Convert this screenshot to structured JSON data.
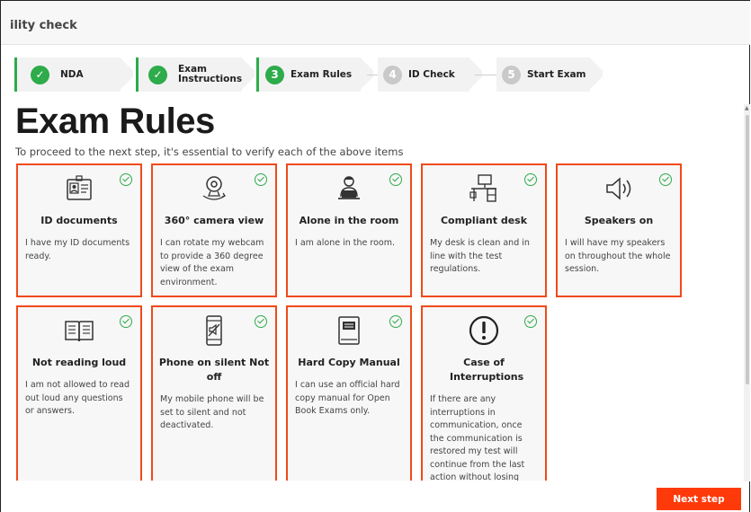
{
  "window": {
    "title": "ility check"
  },
  "stepper": {
    "steps": [
      {
        "label": "NDA",
        "status": "done",
        "number": ""
      },
      {
        "label": "Exam\nInstructions",
        "status": "done",
        "number": ""
      },
      {
        "label": "Exam Rules",
        "status": "active",
        "number": "3"
      },
      {
        "label": "ID Check",
        "status": "todo",
        "number": "4"
      },
      {
        "label": "Start Exam",
        "status": "todo",
        "number": "5"
      }
    ]
  },
  "main": {
    "title": "Exam Rules",
    "subtitle": "To proceed to the next step, it's essential to verify each of the above items"
  },
  "cards": [
    {
      "title": "ID documents",
      "desc": "I have my ID documents ready.",
      "icon": "id-card-icon"
    },
    {
      "title": "360° camera view",
      "desc": "I can rotate my webcam to provide a 360 degree view of the exam environment.",
      "icon": "webcam-rotate-icon"
    },
    {
      "title": "Alone in the room",
      "desc": "I am alone in the room.",
      "icon": "person-at-laptop-icon"
    },
    {
      "title": "Compliant desk",
      "desc": "My desk is clean and in line with the test regulations.",
      "icon": "desk-icon"
    },
    {
      "title": "Speakers on",
      "desc": "I will have my speakers on throughout the whole session.",
      "icon": "speaker-icon"
    },
    {
      "title": "Not reading loud",
      "desc": "I am not allowed to read out loud any questions or answers.",
      "icon": "open-book-icon"
    },
    {
      "title": "Phone on silent Not off",
      "desc": "My mobile phone will be set to silent and not deactivated.",
      "icon": "phone-muted-icon"
    },
    {
      "title": "Hard Copy Manual",
      "desc": "I can use an official hard copy manual for Open Book Exams only.",
      "icon": "manual-book-icon"
    },
    {
      "title": "Case of Interruptions",
      "desc": "If there are any interruptions in communication, once the communication is restored my test will continue from the last action without losing",
      "icon": "exclamation-circle-icon"
    }
  ],
  "footer": {
    "next_label": "Next step"
  },
  "colors": {
    "accent": "#ff3a0a",
    "card_border": "#f04a1a",
    "success": "#2eab4a"
  }
}
